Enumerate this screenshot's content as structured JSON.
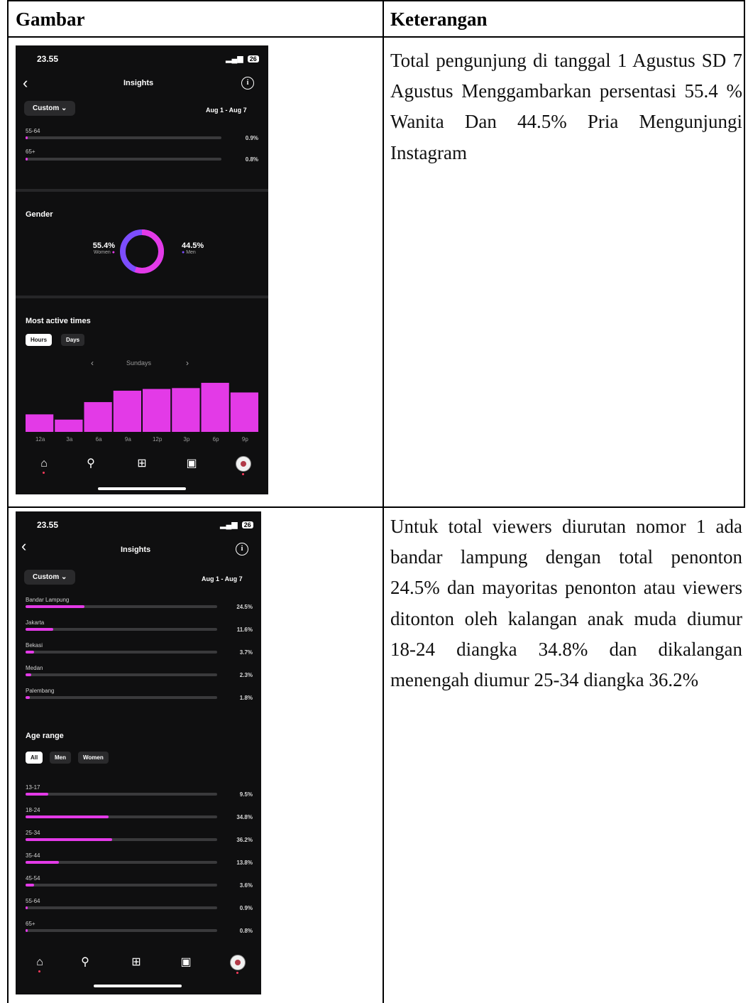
{
  "table": {
    "header_left": "Gambar",
    "header_right": "Keterangan",
    "rows": [
      {
        "description": "Total pengunjung di tanggal 1 Agustus SD 7 Agustus Menggambarkan persentasi 55.4 % Wanita Dan 44.5% Pria Mengunjungi Instagram"
      },
      {
        "description": "Untuk total viewers diurutan nomor 1 ada bandar lampung dengan total penonton 24.5% dan mayoritas penonton atau viewers ditonton oleh kalangan anak muda diumur 18-24 diangka 34.8% dan dikalangan menengah diumur 25-34 diangka 36.2%"
      }
    ]
  },
  "phone1": {
    "time": "23.55",
    "battery": "26",
    "title": "Insights",
    "dropdown": "Custom",
    "date_range": "Aug 1 - Aug 7",
    "age_bars": [
      {
        "label": "55-64",
        "value": "0.9%",
        "fraction": 0.009
      },
      {
        "label": "65+",
        "value": "0.8%",
        "fraction": 0.008
      }
    ],
    "gender": {
      "title": "Gender",
      "women_pct": "55.4%",
      "women_label": "Women",
      "men_pct": "44.5%",
      "men_label": "Men",
      "women_share": 55.4,
      "men_share": 44.6,
      "women_color": "#e33ae7",
      "men_color": "#7c4dff"
    },
    "most_active": {
      "title": "Most active times",
      "tab_on": "Hours",
      "tab_off": "Days",
      "day": "Sundays"
    },
    "nav": [
      "home-icon",
      "search-icon",
      "create-icon",
      "reels-icon",
      "profile-avatar"
    ]
  },
  "chart_data": {
    "type": "bar",
    "categories": [
      "12a",
      "3a",
      "6a",
      "9a",
      "12p",
      "3p",
      "6p",
      "9p"
    ],
    "values": [
      20,
      14,
      34,
      47,
      49,
      50,
      56,
      45
    ],
    "ylim": [
      0,
      60
    ],
    "color": "#e33ae7"
  },
  "phone2": {
    "time": "23.55",
    "battery": "26",
    "title": "Insights",
    "dropdown": "Custom",
    "date_range": "Aug 1 - Aug 7",
    "cities": [
      {
        "label": "Bandar Lampung",
        "value": "24.5%",
        "fraction": 0.245
      },
      {
        "label": "Jakarta",
        "value": "11.6%",
        "fraction": 0.116
      },
      {
        "label": "Bekasi",
        "value": "3.7%",
        "fraction": 0.037
      },
      {
        "label": "Medan",
        "value": "2.3%",
        "fraction": 0.023
      },
      {
        "label": "Palembang",
        "value": "1.8%",
        "fraction": 0.018
      }
    ],
    "age_range_title": "Age range",
    "age_tabs": [
      "All",
      "Men",
      "Women"
    ],
    "ages": [
      {
        "label": "13-17",
        "value": "9.5%",
        "fraction": 0.095
      },
      {
        "label": "18-24",
        "value": "34.8%",
        "fraction": 0.348
      },
      {
        "label": "25-34",
        "value": "36.2%",
        "fraction": 0.362
      },
      {
        "label": "35-44",
        "value": "13.8%",
        "fraction": 0.138
      },
      {
        "label": "45-54",
        "value": "3.6%",
        "fraction": 0.036
      },
      {
        "label": "55-64",
        "value": "0.9%",
        "fraction": 0.009
      },
      {
        "label": "65+",
        "value": "0.8%",
        "fraction": 0.008
      }
    ]
  }
}
